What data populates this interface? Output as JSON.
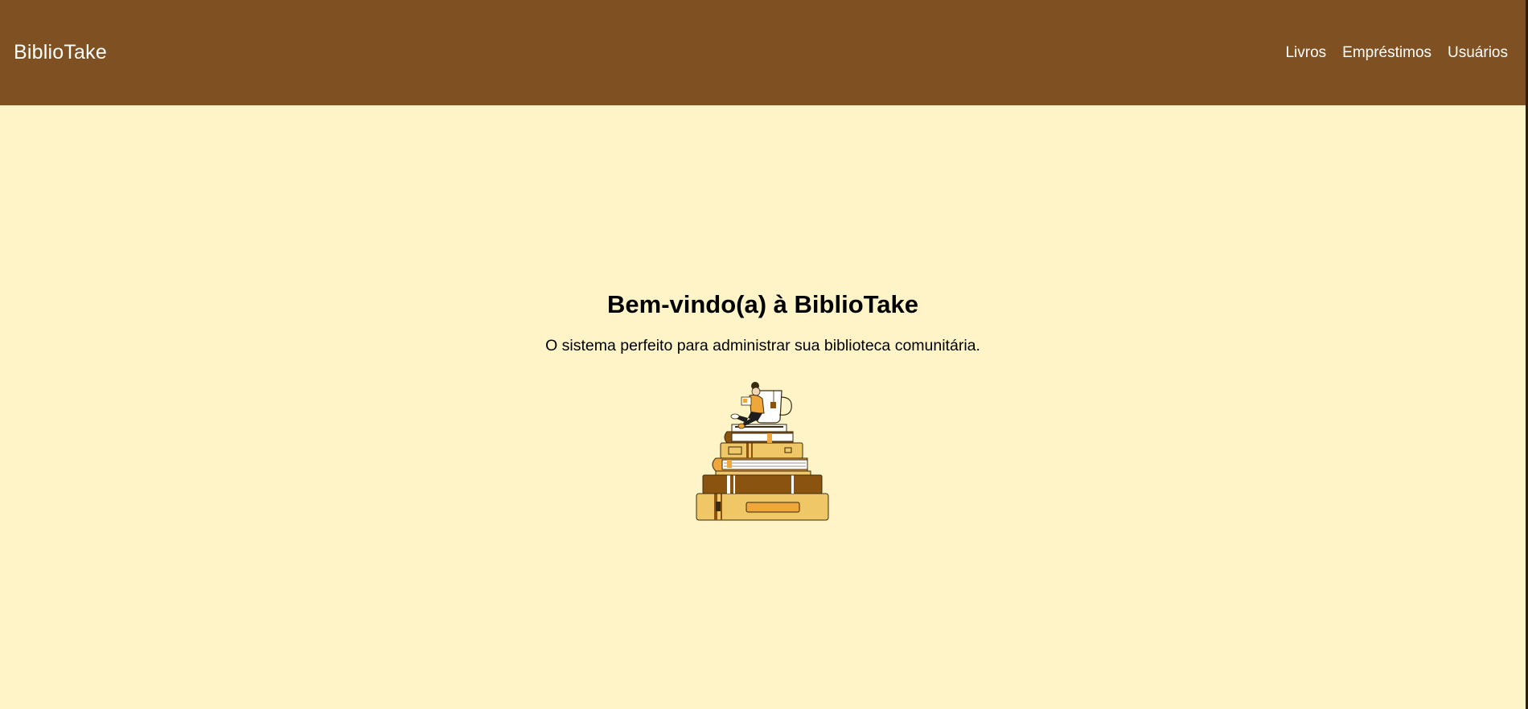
{
  "navbar": {
    "brand": "BiblioTake",
    "links": [
      {
        "label": "Livros"
      },
      {
        "label": "Empréstimos"
      },
      {
        "label": "Usuários"
      }
    ]
  },
  "hero": {
    "title": "Bem-vindo(a) à BiblioTake",
    "subtitle": "O sistema perfeito para administrar sua biblioteca comunitária."
  },
  "illustration": {
    "icon": "reader-on-book-stack-illustration"
  },
  "colors": {
    "navbar_bg": "#7F5022",
    "page_bg": "#FFF4C7",
    "book_light": "#EFC766",
    "book_orange": "#F0A73A",
    "book_dark": "#8A5410"
  }
}
